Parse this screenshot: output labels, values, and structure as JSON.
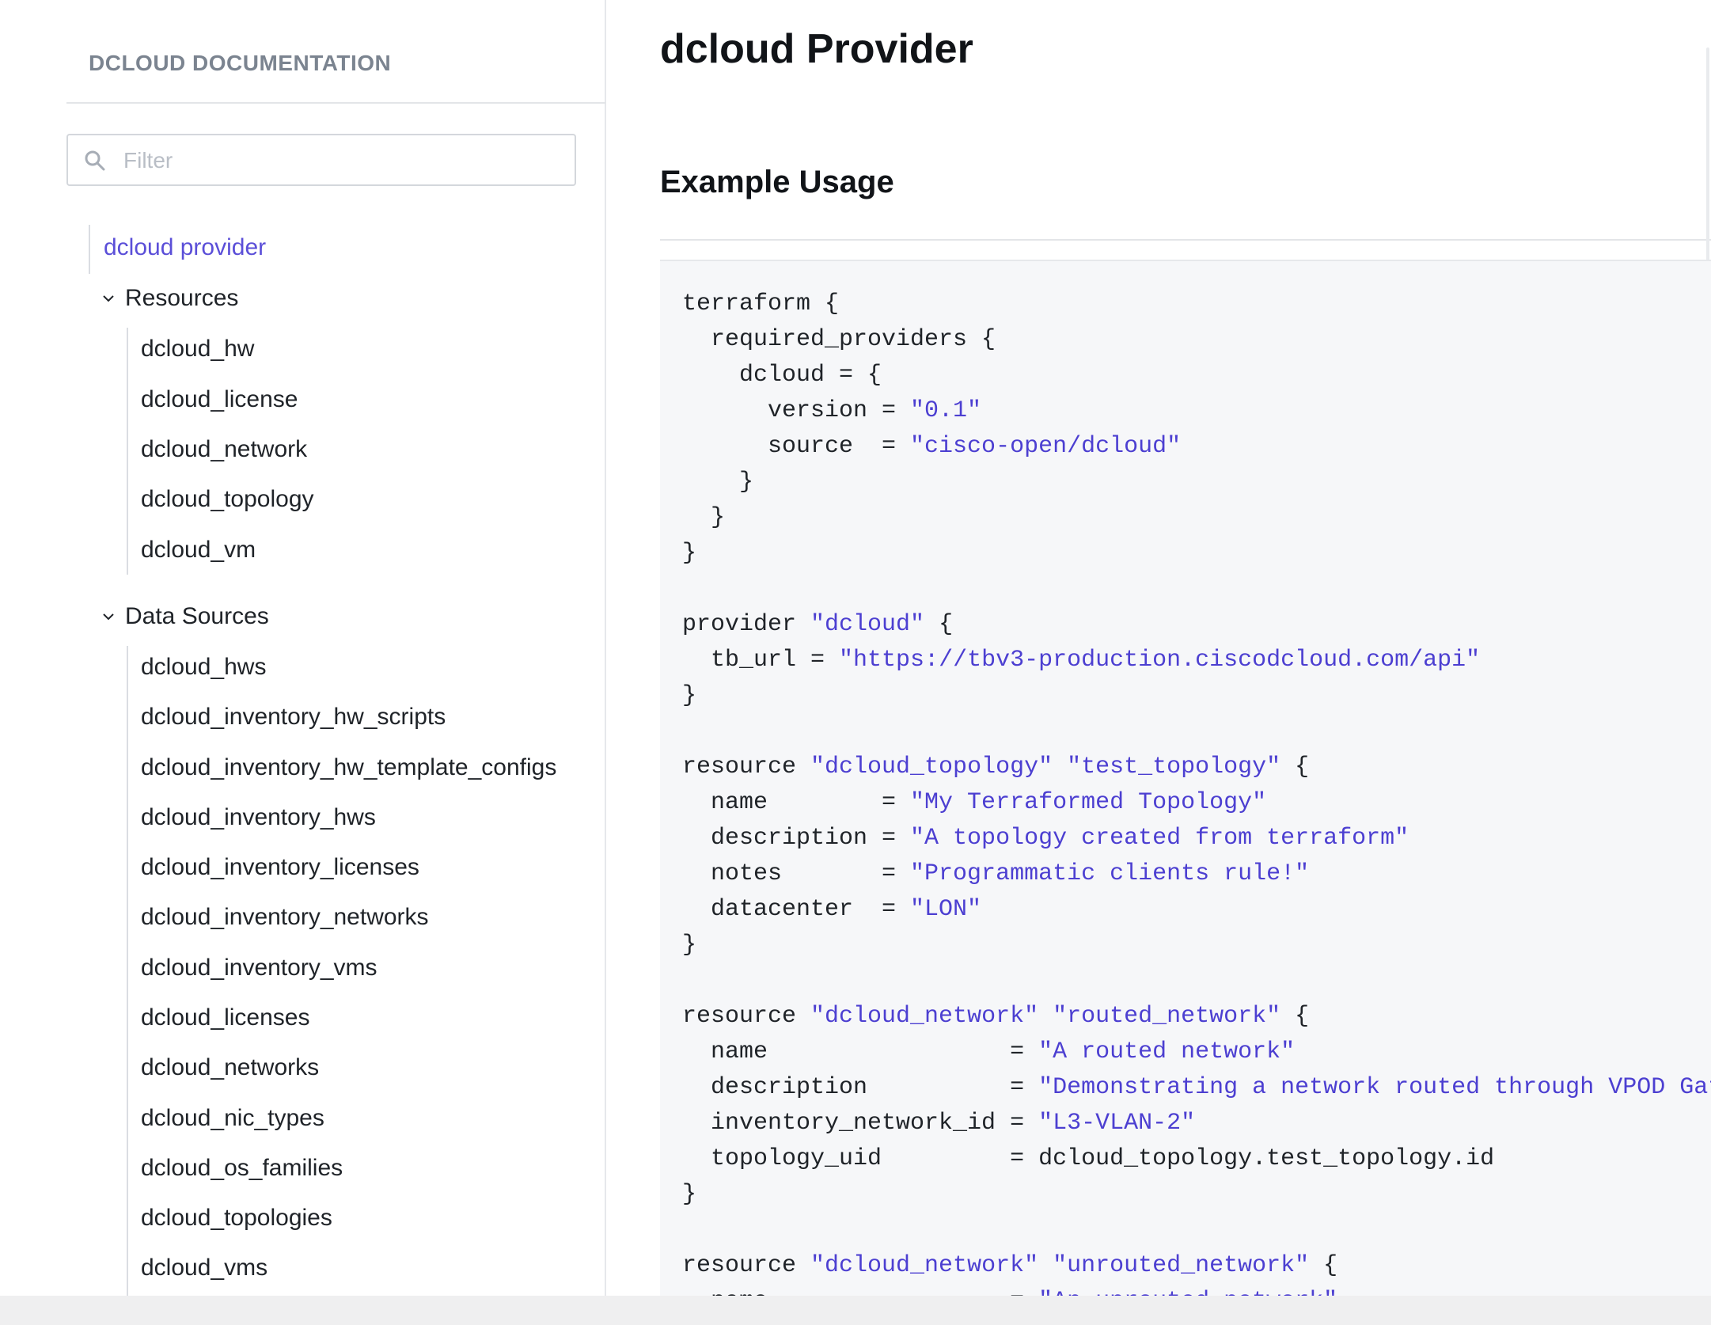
{
  "sidebar": {
    "brand": "DCLOUD DOCUMENTATION",
    "filter_placeholder": "Filter",
    "provider_link": "dcloud provider",
    "sections": [
      {
        "label": "Resources",
        "items": [
          "dcloud_hw",
          "dcloud_license",
          "dcloud_network",
          "dcloud_topology",
          "dcloud_vm"
        ]
      },
      {
        "label": "Data Sources",
        "items": [
          "dcloud_hws",
          "dcloud_inventory_hw_scripts",
          "dcloud_inventory_hw_template_configs",
          "dcloud_inventory_hws",
          "dcloud_inventory_licenses",
          "dcloud_inventory_networks",
          "dcloud_inventory_vms",
          "dcloud_licenses",
          "dcloud_networks",
          "dcloud_nic_types",
          "dcloud_os_families",
          "dcloud_topologies",
          "dcloud_vms"
        ]
      }
    ]
  },
  "main": {
    "title": "dcloud Provider",
    "section_title": "Example Usage",
    "code_lines": [
      "terraform {",
      "  required_providers {",
      "    dcloud = {",
      "      version = \"0.1\"",
      "      source  = \"cisco-open/dcloud\"",
      "    }",
      "  }",
      "}",
      "",
      "provider \"dcloud\" {",
      "  tb_url = \"https://tbv3-production.ciscodcloud.com/api\"",
      "}",
      "",
      "resource \"dcloud_topology\" \"test_topology\" {",
      "  name        = \"My Terraformed Topology\"",
      "  description = \"A topology created from terraform\"",
      "  notes       = \"Programmatic clients rule!\"",
      "  datacenter  = \"LON\"",
      "}",
      "",
      "resource \"dcloud_network\" \"routed_network\" {",
      "  name                 = \"A routed network\"",
      "  description          = \"Demonstrating a network routed through VPOD Gatewa",
      "  inventory_network_id = \"L3-VLAN-2\"",
      "  topology_uid         = dcloud_topology.test_topology.id",
      "}",
      "",
      "resource \"dcloud_network\" \"unrouted_network\" {",
      "  name                 = \"An unrouted network\""
    ]
  },
  "colors": {
    "accent": "#5b4fd8",
    "code_string": "#4c3fd1",
    "code_bg": "#f6f7f9",
    "brand_text": "#7b8490"
  }
}
